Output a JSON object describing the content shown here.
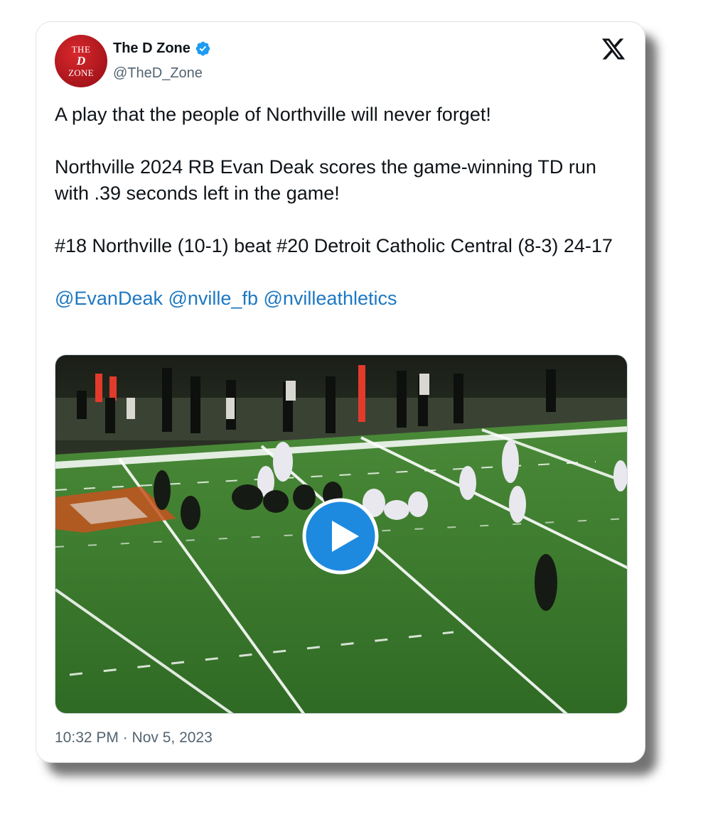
{
  "tweet": {
    "avatar": {
      "line1": "THE",
      "line2": "D",
      "line3": "ZONE"
    },
    "author_name": "The D Zone",
    "handle": "@TheD_Zone",
    "verified": true,
    "platform_icon": "x-logo-icon",
    "text": {
      "line1": "A play that the people of Northville will never forget!",
      "line2": "Northville 2024 RB Evan Deak scores the game-winning TD run with .39 seconds left in the game!",
      "line3": "#18 Northville (10-1) beat #20 Detroit Catholic Central (8-3) 24-17",
      "mentions": [
        "@EvanDeak",
        "@nville_fb",
        "@nvilleathletics"
      ]
    },
    "media": {
      "type": "video",
      "icon": "play-icon"
    },
    "timestamp": "10:32 PM · Nov 5, 2023"
  },
  "colors": {
    "link": "#1d78c2",
    "verified": "#1d9bf0",
    "secondary_text": "#536471",
    "avatar_red": "#b3181e",
    "field_green": "#3c7a2c",
    "play_blue": "#1d8ae0"
  }
}
